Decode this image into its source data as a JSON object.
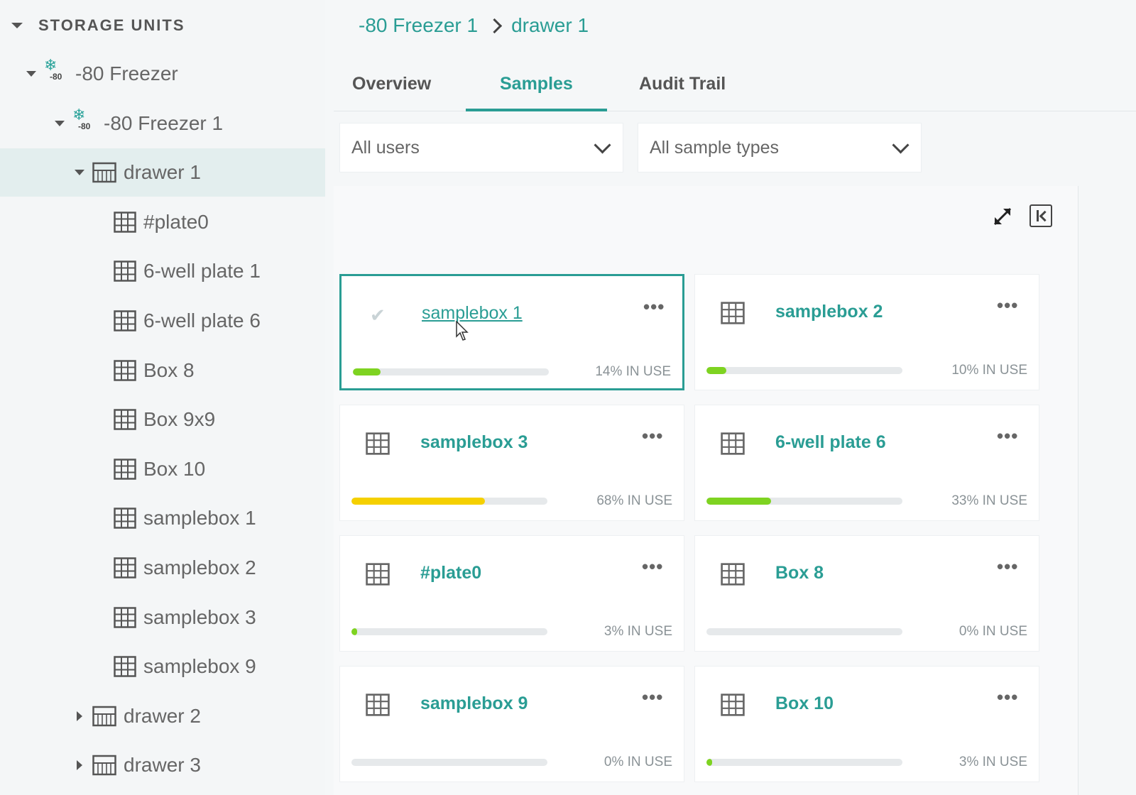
{
  "sidebar": {
    "header": "STORAGE UNITS",
    "tree": [
      {
        "label": "-80 Freezer",
        "icon": "freezer-icon",
        "badge": "-80",
        "depth": 1,
        "expanded": true
      },
      {
        "label": "-80 Freezer 1",
        "icon": "freezer-icon",
        "badge": "-80",
        "depth": 2,
        "expanded": true
      },
      {
        "label": "drawer 1",
        "icon": "drawer-icon",
        "depth": 3,
        "expanded": true,
        "selected": true
      },
      {
        "label": "#plate0",
        "icon": "grid-icon",
        "depth": 4
      },
      {
        "label": "6-well plate 1",
        "icon": "grid-icon",
        "depth": 4
      },
      {
        "label": "6-well plate 6",
        "icon": "grid-icon",
        "depth": 4
      },
      {
        "label": "Box 8",
        "icon": "grid-icon",
        "depth": 4
      },
      {
        "label": "Box 9x9",
        "icon": "grid-icon",
        "depth": 4
      },
      {
        "label": "Box 10",
        "icon": "grid-icon",
        "depth": 4
      },
      {
        "label": "samplebox 1",
        "icon": "grid-icon",
        "depth": 4
      },
      {
        "label": "samplebox 2",
        "icon": "grid-icon",
        "depth": 4
      },
      {
        "label": "samplebox 3",
        "icon": "grid-icon",
        "depth": 4
      },
      {
        "label": "samplebox 9",
        "icon": "grid-icon",
        "depth": 4
      },
      {
        "label": "drawer 2",
        "icon": "drawer-icon",
        "depth": 3,
        "expanded": false
      },
      {
        "label": "drawer 3",
        "icon": "drawer-icon",
        "depth": 3,
        "expanded": false
      }
    ]
  },
  "breadcrumb": {
    "items": [
      "-80 Freezer 1",
      "drawer 1"
    ]
  },
  "tabs": [
    {
      "label": "Overview"
    },
    {
      "label": "Samples",
      "active": true
    },
    {
      "label": "Audit Trail"
    }
  ],
  "filters": {
    "users": "All users",
    "sample_types": "All sample types"
  },
  "toolbar": {
    "expand_icon": "expand-icon",
    "collapse_icon": "collapse-panel-icon"
  },
  "cards": [
    {
      "name": "samplebox 1",
      "usage": "14% IN USE",
      "fill": 0.14,
      "color": "#7ed321",
      "selected": true
    },
    {
      "name": "samplebox 2",
      "usage": "10% IN USE",
      "fill": 0.1,
      "color": "#7ed321"
    },
    {
      "name": "samplebox 3",
      "usage": "68% IN USE",
      "fill": 0.68,
      "color": "#f5d000"
    },
    {
      "name": "6-well plate 6",
      "usage": "33% IN USE",
      "fill": 0.33,
      "color": "#7ed321"
    },
    {
      "name": "#plate0",
      "usage": "3% IN USE",
      "fill": 0.03,
      "color": "#7ed321"
    },
    {
      "name": "Box 8",
      "usage": "0% IN USE",
      "fill": 0.0,
      "color": "#7ed321"
    },
    {
      "name": "samplebox 9",
      "usage": "0% IN USE",
      "fill": 0.0,
      "color": "#7ed321"
    },
    {
      "name": "Box 10",
      "usage": "3% IN USE",
      "fill": 0.03,
      "color": "#7ed321"
    }
  ],
  "colors": {
    "accent": "#2a9d94",
    "bar_track": "#e6e9eb",
    "bar_green": "#7ed321",
    "bar_yellow": "#f5d000"
  }
}
